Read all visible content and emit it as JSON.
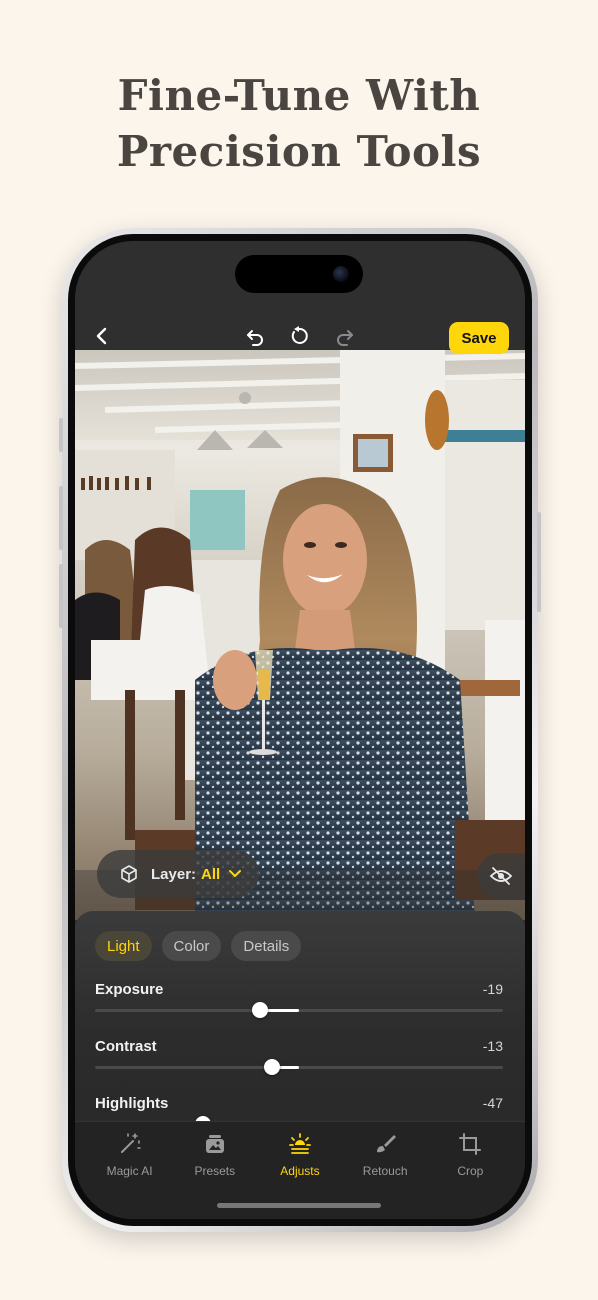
{
  "headline": {
    "line1": "Fine-Tune With",
    "line2": "Precision Tools"
  },
  "topbar": {
    "back_icon": "chevron-left-icon",
    "undo_icon": "undo-icon",
    "reset_icon": "reset-icon",
    "redo_icon": "redo-icon",
    "save_label": "Save"
  },
  "layer": {
    "label": "Layer:",
    "value": "All"
  },
  "panel": {
    "tabs": [
      {
        "label": "Light",
        "active": true
      },
      {
        "label": "Color",
        "active": false
      },
      {
        "label": "Details",
        "active": false
      }
    ],
    "sliders": [
      {
        "name": "Exposure",
        "value": "-19",
        "level": -19
      },
      {
        "name": "Contrast",
        "value": "-13",
        "level": -13
      },
      {
        "name": "Highlights",
        "value": "-47",
        "level": -47
      }
    ]
  },
  "nav": {
    "items": [
      {
        "label": "Magic AI",
        "icon": "magic-wand-icon"
      },
      {
        "label": "Presets",
        "icon": "presets-icon"
      },
      {
        "label": "Adjusts",
        "icon": "adjust-sun-icon",
        "active": true
      },
      {
        "label": "Retouch",
        "icon": "brush-icon"
      },
      {
        "label": "Crop",
        "icon": "crop-icon"
      }
    ]
  },
  "colors": {
    "accent": "#ffd60a",
    "background": "#fbf5ec",
    "panel": "#2c2c2d"
  }
}
